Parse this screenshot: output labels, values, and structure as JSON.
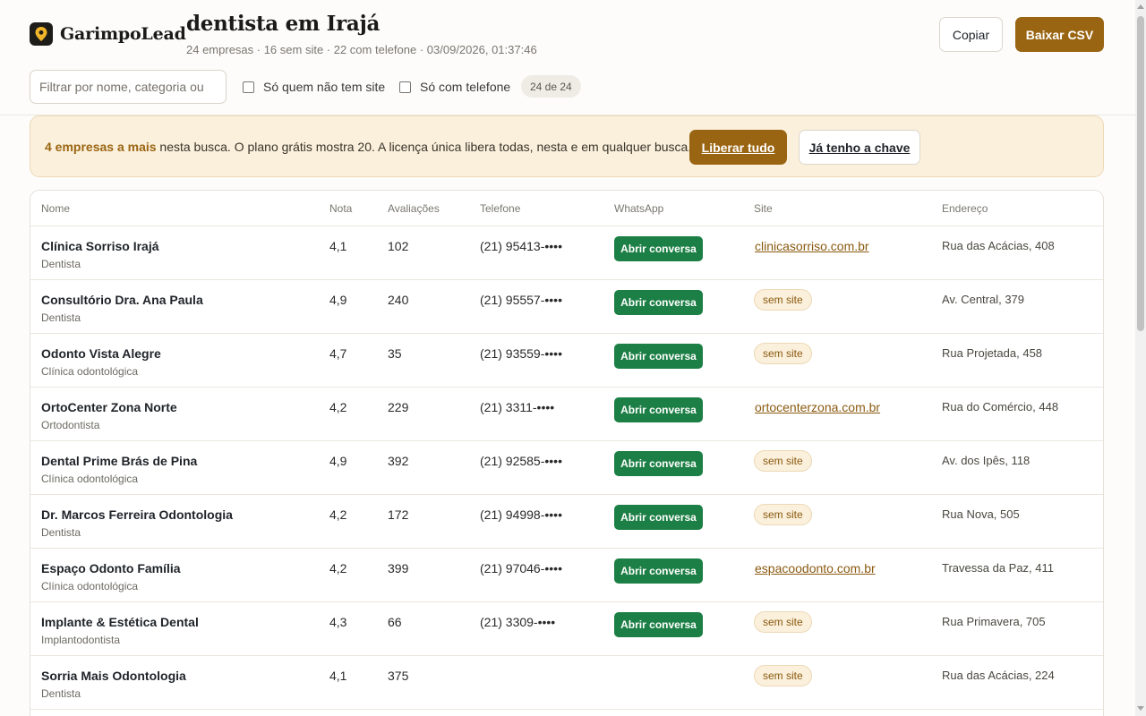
{
  "brand": {
    "name": "GarimpoLead",
    "icon": "map-pin-icon"
  },
  "header": {
    "title": "dentista em Irajá",
    "subtitle": "24 empresas · 16 sem site · 22 com telefone · 03/09/2026, 01:37:46",
    "copy_label": "Copiar",
    "csv_label": "Baixar CSV"
  },
  "filters": {
    "search_placeholder": "Filtrar por nome, categoria ou",
    "no_site_label": "Só quem não tem site",
    "no_site_checked": false,
    "with_phone_label": "Só com telefone",
    "with_phone_checked": false,
    "count": "24 de 24"
  },
  "banner": {
    "highlight": "4 empresas a mais",
    "text": " nesta busca. O plano grátis mostra 20. A licença única libera todas, nesta e em qualquer busca.",
    "unlock_label": "Liberar tudo",
    "key_label": "Já tenho a chave"
  },
  "table": {
    "columns": [
      "Nome",
      "Nota",
      "Avaliações",
      "Telefone",
      "WhatsApp",
      "Site",
      "Endereço"
    ],
    "whatsapp_label": "Abrir conversa",
    "no_site_label": "sem site",
    "rows": [
      {
        "name": "Clínica Sorriso Irajá",
        "category": "Dentista",
        "rating": "4,1",
        "reviews": "102",
        "phone": "(21) 95413-••••",
        "whatsapp": true,
        "site": "clinicasorriso.com.br",
        "address": "Rua das Acácias, 408"
      },
      {
        "name": "Consultório Dra. Ana Paula",
        "category": "Dentista",
        "rating": "4,9",
        "reviews": "240",
        "phone": "(21) 95557-••••",
        "whatsapp": true,
        "site": "",
        "address": "Av. Central, 379"
      },
      {
        "name": "Odonto Vista Alegre",
        "category": "Clínica odontológica",
        "rating": "4,7",
        "reviews": "35",
        "phone": "(21) 93559-••••",
        "whatsapp": true,
        "site": "",
        "address": "Rua Projetada, 458"
      },
      {
        "name": "OrtoCenter Zona Norte",
        "category": "Ortodontista",
        "rating": "4,2",
        "reviews": "229",
        "phone": "(21) 3311-••••",
        "whatsapp": true,
        "site": "ortocenterzona.com.br",
        "address": "Rua do Comércio, 448"
      },
      {
        "name": "Dental Prime Brás de Pina",
        "category": "Clínica odontológica",
        "rating": "4,9",
        "reviews": "392",
        "phone": "(21) 92585-••••",
        "whatsapp": true,
        "site": "",
        "address": "Av. dos Ipês, 118"
      },
      {
        "name": "Dr. Marcos Ferreira Odontologia",
        "category": "Dentista",
        "rating": "4,2",
        "reviews": "172",
        "phone": "(21) 94998-••••",
        "whatsapp": true,
        "site": "",
        "address": "Rua Nova, 505"
      },
      {
        "name": "Espaço Odonto Família",
        "category": "Clínica odontológica",
        "rating": "4,2",
        "reviews": "399",
        "phone": "(21) 97046-••••",
        "whatsapp": true,
        "site": "espacoodonto.com.br",
        "address": "Travessa da Paz, 411"
      },
      {
        "name": "Implante & Estética Dental",
        "category": "Implantodontista",
        "rating": "4,3",
        "reviews": "66",
        "phone": "(21) 3309-••••",
        "whatsapp": true,
        "site": "",
        "address": "Rua Primavera, 705"
      },
      {
        "name": "Sorria Mais Odontologia",
        "category": "Dentista",
        "rating": "4,1",
        "reviews": "375",
        "phone": "",
        "whatsapp": false,
        "site": "",
        "address": "Rua das Acácias, 224"
      }
    ]
  },
  "colors": {
    "accent": "#9a6512",
    "whatsapp": "#1c7f45",
    "banner_bg": "#fbf0dc"
  }
}
